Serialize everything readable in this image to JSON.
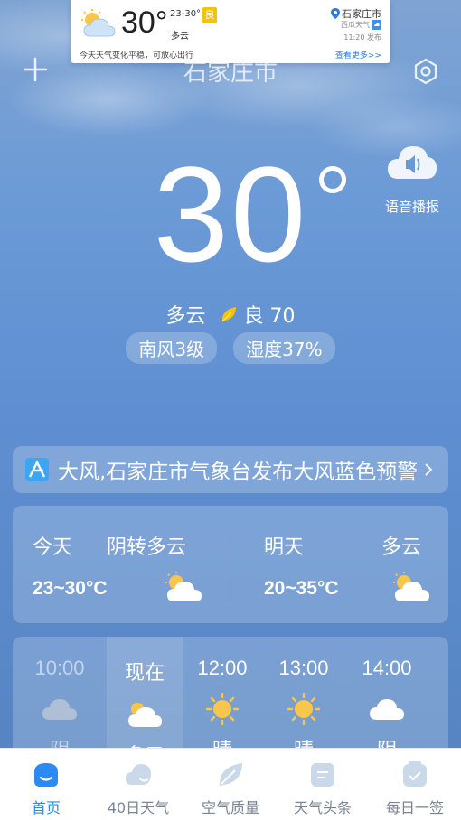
{
  "notification": {
    "temp": "30°",
    "range": "23-30°",
    "aqi": "良",
    "condition": "多云",
    "tip": "今天天气变化平稳，可放心出行",
    "city": "石家庄市",
    "source": "西瓜天气",
    "publish_time": "11:20 发布",
    "more": "查看更多>>"
  },
  "header": {
    "city": "石家庄市"
  },
  "voice": {
    "label": "语音播报"
  },
  "current": {
    "temp": "30",
    "condition": "多云",
    "aqi_label": "良 70",
    "wind": "南风3级",
    "humidity": "湿度37%"
  },
  "alert": {
    "text": "大风,石家庄市气象台发布大风蓝色预警"
  },
  "forecast": [
    {
      "day": "今天",
      "condition": "阴转多云",
      "range": "23~30°C",
      "icon": "partly-cloudy-icon"
    },
    {
      "day": "明天",
      "condition": "多云",
      "range": "20~35°C",
      "icon": "partly-cloudy-icon"
    }
  ],
  "hourly": [
    {
      "time": "10:00",
      "condition": "阴",
      "icon": "cloudy-icon",
      "state": "past"
    },
    {
      "time": "现在",
      "condition": "多云",
      "icon": "partly-cloudy-icon",
      "state": "now"
    },
    {
      "time": "12:00",
      "condition": "晴",
      "icon": "sun-icon",
      "state": "future"
    },
    {
      "time": "13:00",
      "condition": "晴",
      "icon": "sun-icon",
      "state": "future"
    },
    {
      "time": "14:00",
      "condition": "阴",
      "icon": "cloudy-icon",
      "state": "future"
    }
  ],
  "tabs": [
    {
      "label": "首页",
      "icon": "home-icon",
      "active": true
    },
    {
      "label": "40日天气",
      "icon": "forecast-40-icon",
      "active": false
    },
    {
      "label": "空气质量",
      "icon": "leaf-icon",
      "active": false
    },
    {
      "label": "天气头条",
      "icon": "news-icon",
      "active": false
    },
    {
      "label": "每日一签",
      "icon": "daily-sign-icon",
      "active": false
    }
  ],
  "colors": {
    "accent": "#2b8bf2",
    "aqi_good": "#f2c500",
    "sun": "#f8c64a"
  }
}
